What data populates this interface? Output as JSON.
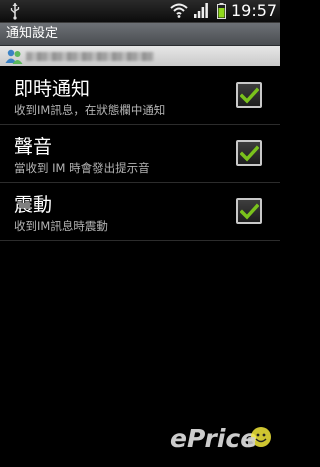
{
  "status_bar": {
    "time": "19:57",
    "icons": [
      "usb-icon",
      "wifi-icon",
      "signal-icon",
      "battery-icon"
    ]
  },
  "title_bar": {
    "title": "通知設定"
  },
  "account_bar": {
    "icon": "accounts-icon"
  },
  "settings": [
    {
      "label": "即時通知",
      "summary": "收到IM訊息，在狀態欄中通知",
      "checked": true
    },
    {
      "label": "聲音",
      "summary": "當收到 IM 時會發出提示音",
      "checked": true
    },
    {
      "label": "震動",
      "summary": "收到IM訊息時震動",
      "checked": true
    }
  ],
  "watermark": {
    "text": "ePrice"
  },
  "colors": {
    "check": "#7ac21c",
    "title_bar": "#5b5f63"
  }
}
